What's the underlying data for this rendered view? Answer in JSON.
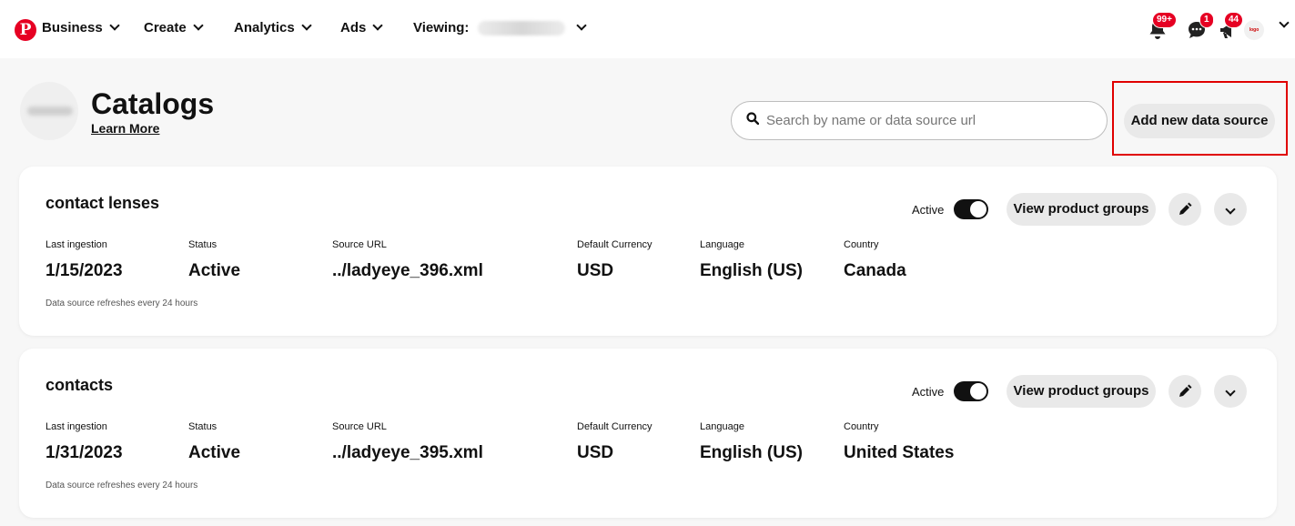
{
  "nav": {
    "business": "Business",
    "create": "Create",
    "analytics": "Analytics",
    "ads": "Ads",
    "viewing": "Viewing:"
  },
  "notifications": {
    "bell_badge": "99+",
    "messages_badge": "1",
    "updates_badge": "44"
  },
  "header": {
    "title": "Catalogs",
    "learn_more": "Learn More"
  },
  "search": {
    "placeholder": "Search by name or data source url",
    "value": ""
  },
  "add_button": "Add new data source",
  "field_labels": {
    "last_ingestion": "Last ingestion",
    "status": "Status",
    "source_url": "Source URL",
    "default_currency": "Default Currency",
    "language": "Language",
    "country": "Country"
  },
  "catalogs": [
    {
      "name": "contact lenses",
      "active_label": "Active",
      "view_groups": "View product groups",
      "last_ingestion": "1/15/2023",
      "status": "Active",
      "source_url": "../ladyeye_396.xml",
      "currency": "USD",
      "language": "English (US)",
      "country": "Canada",
      "refresh_note": "Data source refreshes every 24 hours"
    },
    {
      "name": "contacts",
      "active_label": "Active",
      "view_groups": "View product groups",
      "last_ingestion": "1/31/2023",
      "status": "Active",
      "source_url": "../ladyeye_395.xml",
      "currency": "USD",
      "language": "English (US)",
      "country": "United States",
      "refresh_note": "Data source refreshes every 24 hours"
    }
  ],
  "colors": {
    "brand": "#e60023",
    "highlight": "#e00000",
    "button_bg": "#e9e9e9"
  }
}
